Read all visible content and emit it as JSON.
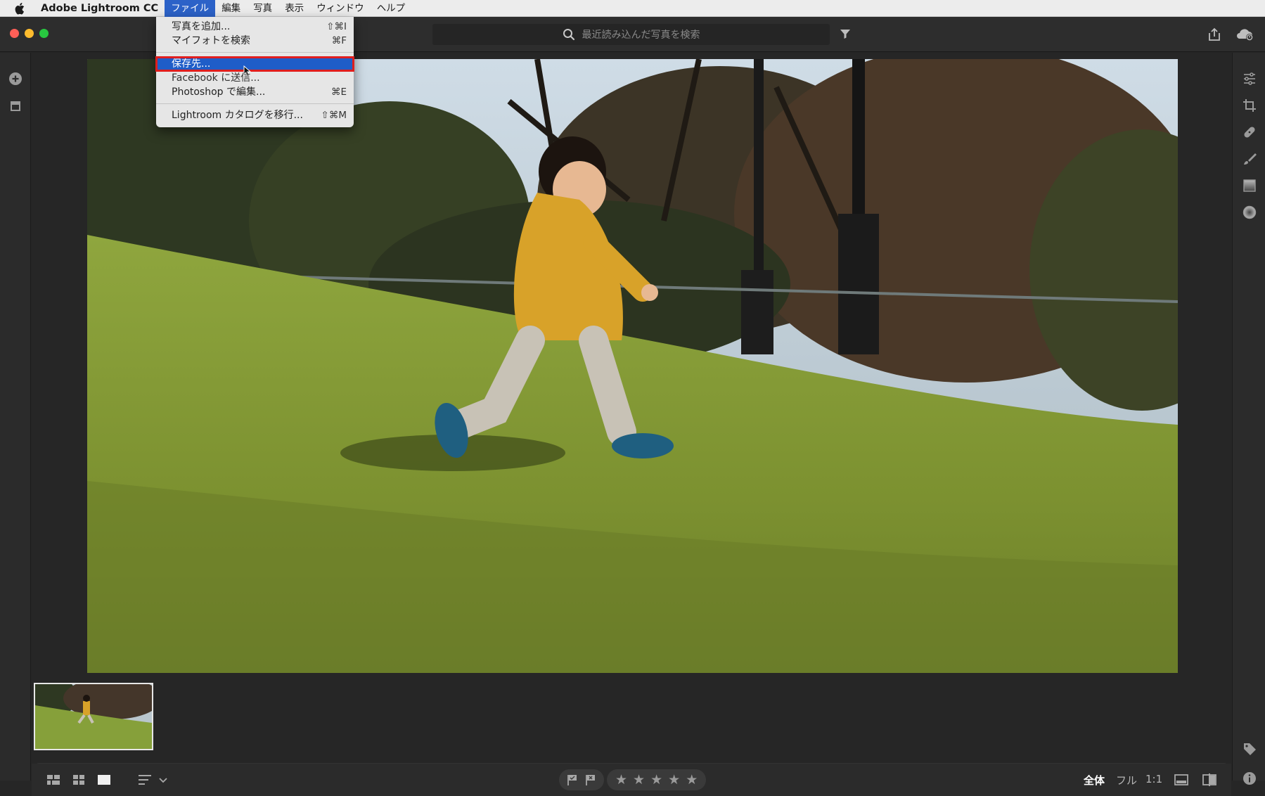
{
  "menubar": {
    "app_name": "Adobe Lightroom CC",
    "items": [
      "ファイル",
      "編集",
      "写真",
      "表示",
      "ウィンドウ",
      "ヘルプ"
    ],
    "active_item": "ファイル"
  },
  "file_menu": {
    "items": [
      {
        "label": "写真を追加...",
        "shortcut": "⇧⌘I"
      },
      {
        "label": "マイフォトを検索",
        "shortcut": "⌘F"
      },
      {
        "label": "保存先...",
        "shortcut": "",
        "highlighted": true
      },
      {
        "label": "Facebook に送信...",
        "shortcut": ""
      },
      {
        "label": "Photoshop で編集...",
        "shortcut": "⌘E"
      },
      {
        "label": "Lightroom カタログを移行...",
        "shortcut": "⇧⌘M"
      }
    ]
  },
  "search": {
    "placeholder": "最近読み込んだ写真を検索"
  },
  "bottom_bar": {
    "zoom_options": [
      "全体",
      "フル",
      "1:1"
    ],
    "active_zoom": "全体",
    "stars": [
      "★",
      "★",
      "★",
      "★",
      "★"
    ]
  },
  "icons": {
    "left_rail": [
      "add-photos-icon",
      "archive-icon"
    ],
    "right_rail": [
      "edit-sliders-icon",
      "crop-icon",
      "healing-brush-icon",
      "brush-icon",
      "linear-gradient-icon",
      "radial-gradient-icon",
      "keyword-tag-icon",
      "info-icon"
    ],
    "title_bar": [
      "search-icon",
      "filter-icon",
      "share-icon",
      "cloud-sync-icon"
    ]
  },
  "colors": {
    "menu_highlight": "#1f5dc8",
    "highlight_outline": "#e01e1e",
    "app_background": "#262626"
  }
}
